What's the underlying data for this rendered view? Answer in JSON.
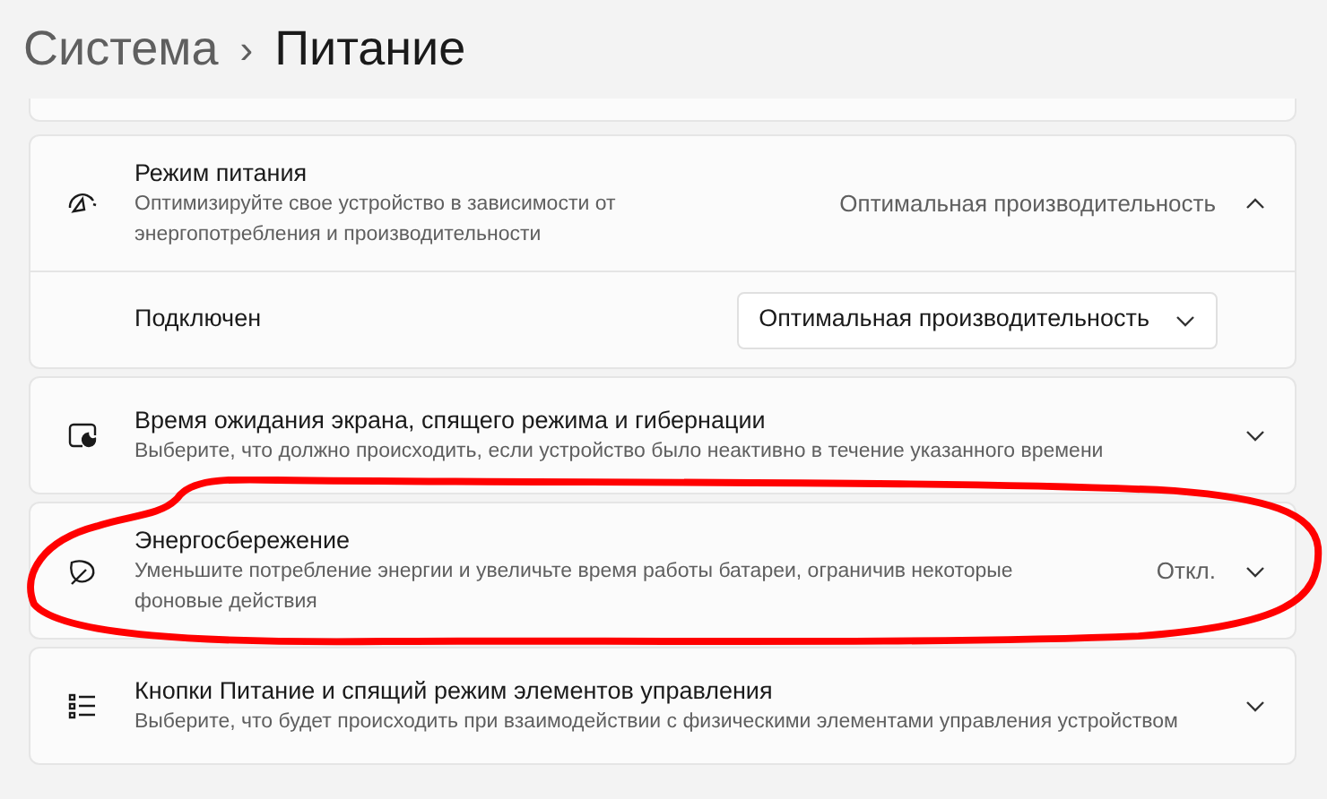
{
  "breadcrumb": {
    "parent": "Система",
    "separator": "›",
    "current": "Питание"
  },
  "cards": [
    {
      "kind": "expander",
      "title": "Режим питания",
      "description": "Оптимизируйте свое устройство в зависимости от энергопотребления и производительности",
      "value": "Оптимальная производительность",
      "expanded": true,
      "highlighted": false,
      "rows": [
        {
          "label": "Подключен",
          "dropdown": "Оптимальная производительность"
        }
      ]
    },
    {
      "kind": "expander",
      "title": "Время ожидания экрана, спящего режима и гибернации",
      "description": "Выберите, что должно происходить, если устройство было неактивно в течение указанного времени",
      "expanded": false,
      "highlighted": false
    },
    {
      "kind": "expander",
      "title": "Энергосбережение",
      "description": "Уменьшите потребление энергии и увеличьте время работы батареи, ограничив некоторые фоновые действия",
      "value": "Откл.",
      "expanded": false,
      "highlighted": true
    },
    {
      "kind": "expander",
      "title": "Кнопки Питание и спящий режим элементов управления",
      "description": "Выберите, что будет происходить при взаимодействии с физическими элементами управления устройством",
      "expanded": false,
      "highlighted": false
    }
  ]
}
